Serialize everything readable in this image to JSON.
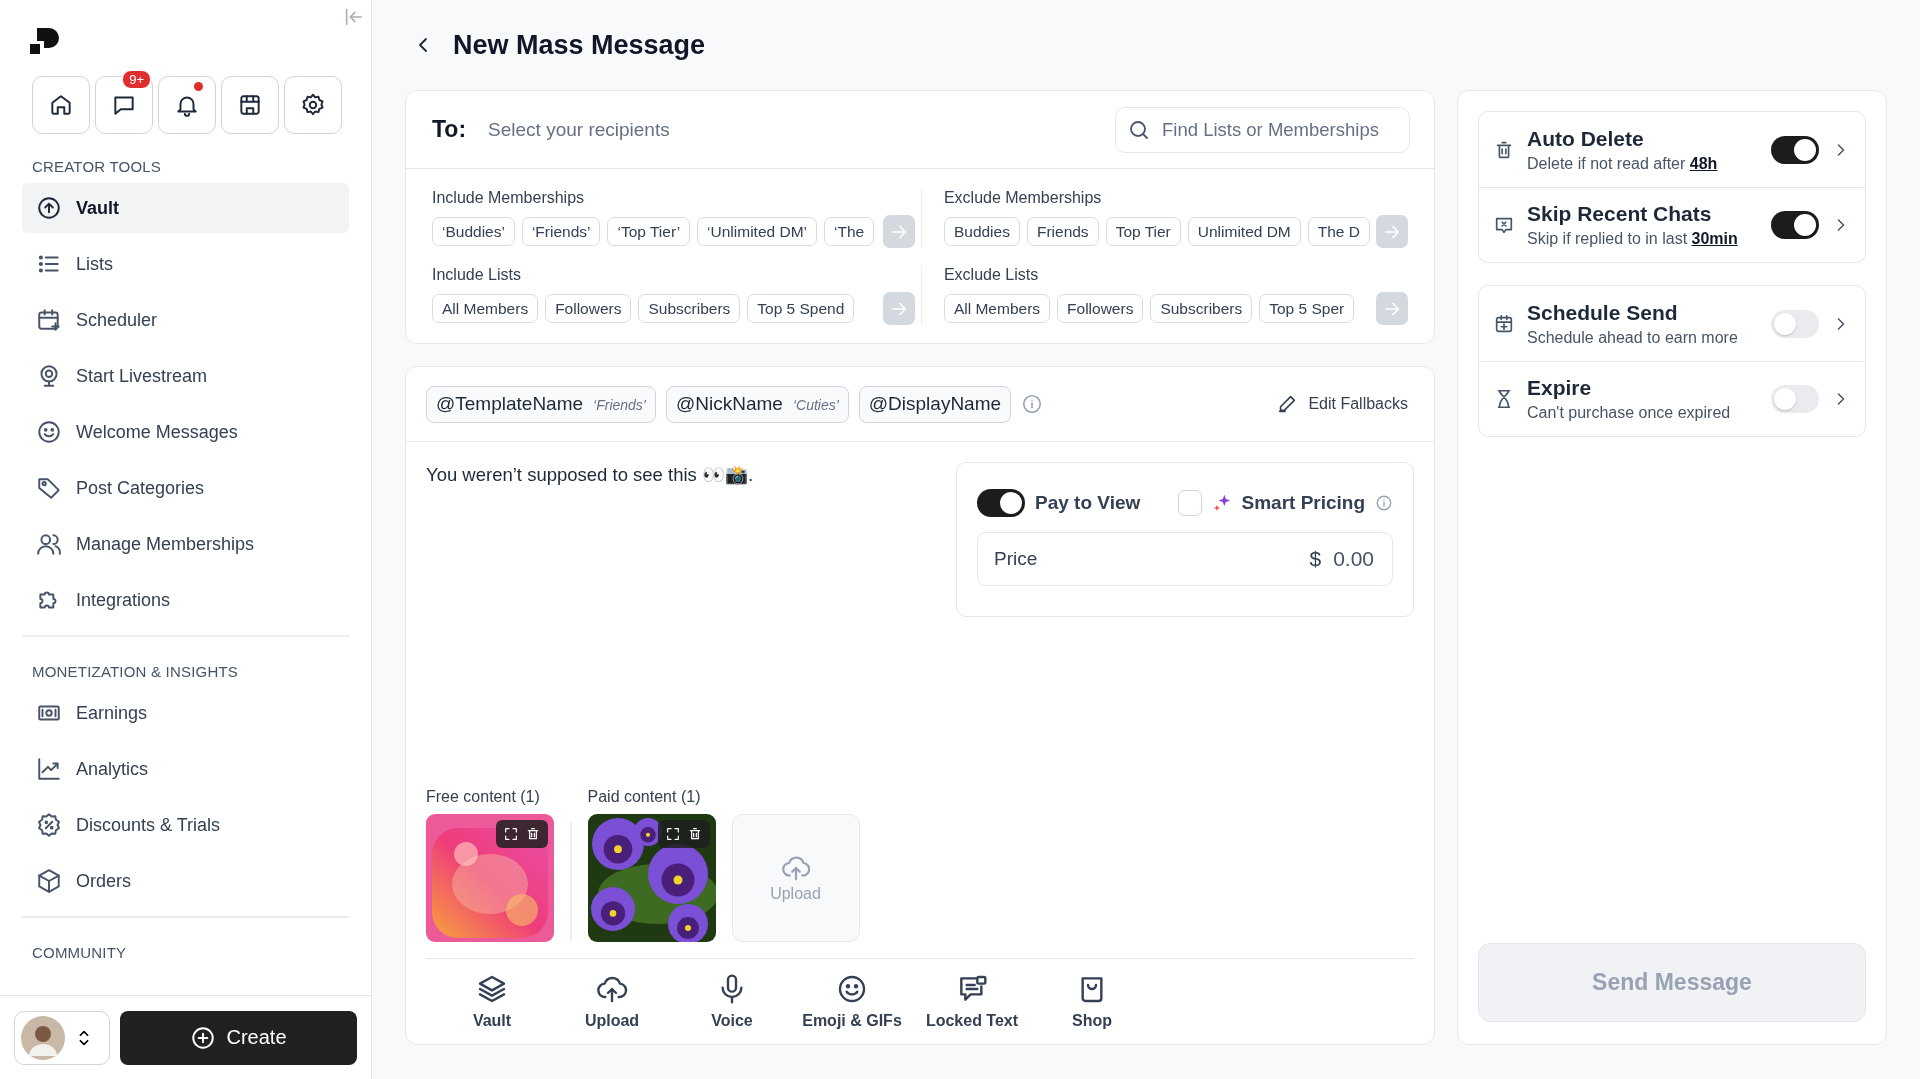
{
  "sidebar": {
    "top_icons": [
      {
        "unread": false
      },
      {
        "badge": "9+",
        "unread": false
      },
      {
        "unread": true
      },
      {
        "unread": false
      },
      {
        "unread": false
      }
    ],
    "sections": [
      {
        "title": "CREATOR TOOLS",
        "items": [
          {
            "label": "Vault",
            "selected": true
          },
          {
            "label": "Lists",
            "selected": false
          },
          {
            "label": "Scheduler",
            "selected": false
          },
          {
            "label": "Start Livestream",
            "selected": false
          },
          {
            "label": "Welcome Messages",
            "selected": false
          },
          {
            "label": "Post Categories",
            "selected": false
          },
          {
            "label": "Manage Memberships",
            "selected": false
          },
          {
            "label": "Integrations",
            "selected": false
          }
        ]
      },
      {
        "title": "MONETIZATION & INSIGHTS",
        "items": [
          {
            "label": "Earnings",
            "selected": false
          },
          {
            "label": "Analytics",
            "selected": false
          },
          {
            "label": "Discounts & Trials",
            "selected": false
          },
          {
            "label": "Orders",
            "selected": false
          }
        ]
      },
      {
        "title": "COMMUNITY"
      }
    ],
    "create_button": "Create"
  },
  "header": {
    "title": "New Mass Message"
  },
  "recipients": {
    "label": "To:",
    "placeholder": "Select your recipients",
    "search_placeholder": "Find Lists or Memberships",
    "groups": [
      {
        "title": "Include Memberships",
        "chips": [
          "‘Buddies’",
          "‘Friends’",
          "‘Top Tier’",
          "‘Unlimited DM’",
          "‘The"
        ]
      },
      {
        "title": "Exclude Memberships",
        "chips": [
          "Buddies",
          "Friends",
          "Top Tier",
          "Unlimited DM",
          "The D"
        ]
      },
      {
        "title": "Include Lists",
        "chips": [
          "All Members",
          "Followers",
          "Subscribers",
          "Top 5 Spend"
        ]
      },
      {
        "title": "Exclude Lists",
        "chips": [
          "All Members",
          "Followers",
          "Subscribers",
          "Top 5 Sper"
        ]
      }
    ]
  },
  "variables": [
    {
      "name": "@TemplateName",
      "fallback": "‘Friends’"
    },
    {
      "name": "@NickName",
      "fallback": "‘Cuties’"
    },
    {
      "name": "@DisplayName"
    }
  ],
  "edit_fallbacks": "Edit Fallbacks",
  "message": "You weren’t supposed to see this 👀📸.",
  "pricing": {
    "pay_to_view": {
      "label": "Pay to View",
      "on": true
    },
    "smart_pricing": {
      "label": "Smart Pricing",
      "checked": false
    },
    "price_label": "Price",
    "currency": "$",
    "value": "0.00"
  },
  "content": [
    {
      "label": "Free content (1)"
    },
    {
      "label": "Paid content (1)"
    }
  ],
  "upload_tile": "Upload",
  "toolbar": [
    "Vault",
    "Upload",
    "Voice",
    "Emoji & GIFs",
    "Locked Text",
    "Shop"
  ],
  "options": [
    [
      {
        "title": "Auto Delete",
        "subtitle": "Delete if not read after",
        "value": "48h",
        "on": true
      },
      {
        "title": "Skip Recent Chats",
        "subtitle": "Skip if replied to in last",
        "value": "30min",
        "on": true
      }
    ],
    [
      {
        "title": "Schedule Send",
        "subtitle": "Schedule ahead to earn more",
        "on": false
      },
      {
        "title": "Expire",
        "subtitle": "Can't purchase once expired",
        "on": false
      }
    ]
  ],
  "send_button": {
    "label": "Send Message",
    "disabled": true
  }
}
